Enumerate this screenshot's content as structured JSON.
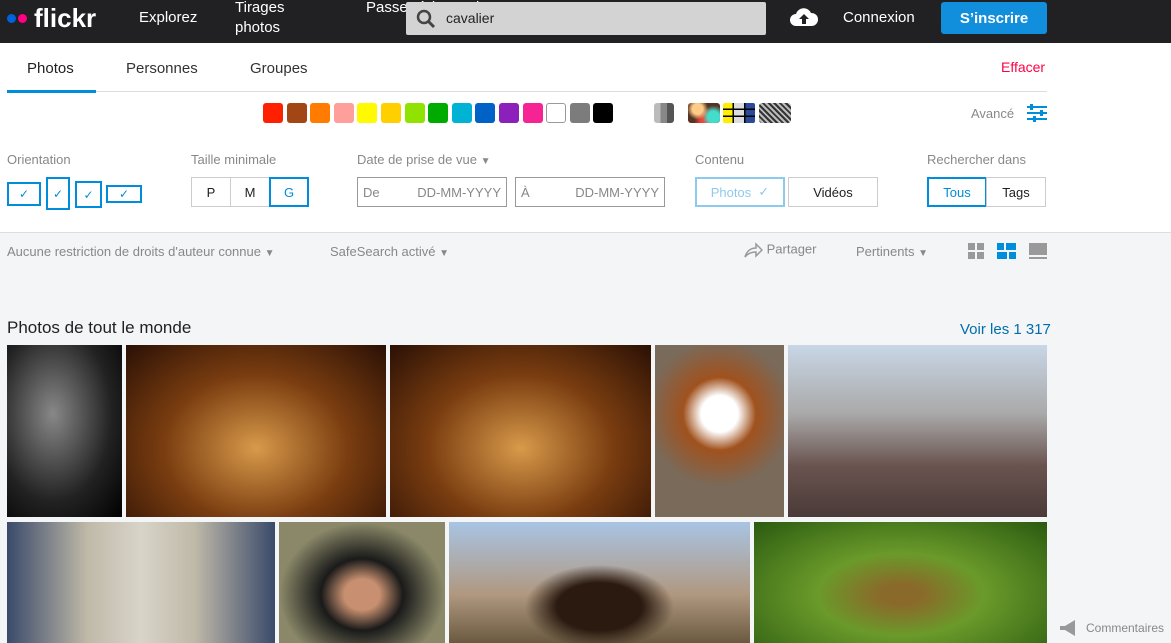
{
  "header": {
    "logo": "flickr",
    "nav": [
      "Explorez",
      "Tirages photos",
      "Passez à la version Pro"
    ],
    "search_value": "cavalier",
    "login": "Connexion",
    "signup": "S’inscrire"
  },
  "tabs": [
    {
      "label": "Photos",
      "active": true
    },
    {
      "label": "Personnes"
    },
    {
      "label": "Groupes"
    }
  ],
  "clear": "Effacer",
  "colors": [
    "#ff2000",
    "#a24615",
    "#ff7c00",
    "#ff9f9c",
    "#fffa00",
    "#ffcf00",
    "#90e200",
    "#00ab00",
    "#00b2d4",
    "#0062c6",
    "#8c20ba",
    "#f52394",
    "#ffffff",
    "#7c7c7c",
    "#000000"
  ],
  "advanced": "Avancé",
  "filters": {
    "orientation": "Orientation",
    "size": {
      "label": "Taille minimale",
      "options": [
        "P",
        "M",
        "G"
      ],
      "selected": "G"
    },
    "date": {
      "label": "Date de prise de vue",
      "from": "De",
      "to": "À",
      "placeholder": "DD-MM-YYYY"
    },
    "content": {
      "label": "Contenu",
      "options": [
        "Photos",
        "Vidéos"
      ],
      "selected": "Photos"
    },
    "search_in": {
      "label": "Rechercher dans",
      "options": [
        "Tous",
        "Tags"
      ],
      "selected": "Tous"
    }
  },
  "toolbar": {
    "license": "Aucune restriction de droits d'auteur connue",
    "safesearch": "SafeSearch activé",
    "share": "Partager",
    "sort": "Pertinents"
  },
  "section": {
    "title": "Photos de tout le monde",
    "see_all": "Voir les 1 317"
  },
  "feedback": "Commentaires",
  "accent": "#008ddc"
}
